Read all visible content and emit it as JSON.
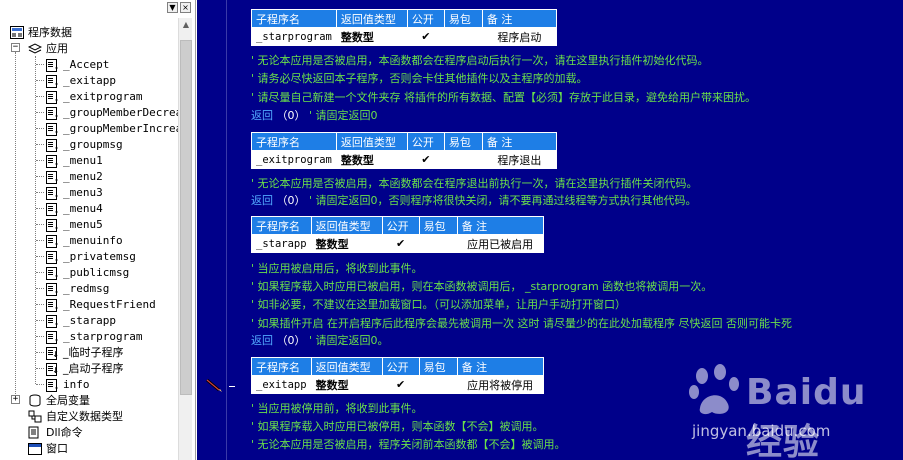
{
  "left_panel": {
    "controls": [
      "▼",
      "×"
    ],
    "tree": {
      "root": "程序数据",
      "app_node": "应用",
      "subprograms": [
        "_Accept",
        "_exitapp",
        "_exitprogram",
        "_groupMemberDecrea",
        "_groupMemberIncrea",
        "_groupmsg",
        "_menu1",
        "_menu2",
        "_menu3",
        "_menu4",
        "_menu5",
        "_menuinfo",
        "_privatemsg",
        "_publicmsg",
        "_redmsg",
        "_RequestFriend",
        "_starapp",
        "_starprogram",
        "_临时子程序",
        "_启动子程序",
        "info"
      ],
      "globals": "全局变量",
      "custom_types": "自定义数据类型",
      "dll": "Dll命令",
      "window": "窗口"
    }
  },
  "editor": {
    "table_headers": [
      "子程序名",
      "返回值类型",
      "公开",
      "易包",
      "备 注"
    ],
    "check_mark": "✔",
    "blocks": [
      {
        "name": "_starprogram",
        "ret_type": "整数型",
        "note": "程序启动",
        "comments": [
          "' 无论本应用是否被启用，本函数都会在程序启动后执行一次，请在这里执行插件初始化代码。",
          "' 请务必尽快返回本子程序，否则会卡住其他插件以及主程序的加载。",
          "' 请尽量自己新建一个文件夹存  将插件的所有数据、配置【必须】存放于此目录，避免给用户带来困扰。"
        ],
        "return_line": {
          "keyword": "返回",
          "value": "（0）",
          "comment": "' 请固定返回0"
        }
      },
      {
        "name": "_exitprogram",
        "ret_type": "整数型",
        "note": "程序退出",
        "comments": [
          "' 无论本应用是否被启用，本函数都会在程序退出前执行一次，请在这里执行插件关闭代码。"
        ],
        "return_line": {
          "keyword": "返回",
          "value": "（0）",
          "comment": "' 请固定返回0，否则程序将很快关闭，请不要再通过线程等方式执行其他代码。"
        }
      },
      {
        "name": "_starapp",
        "ret_type": "整数型",
        "note": "应用已被启用",
        "comments": [
          "' 当应用被启用后，将收到此事件。",
          "' 如果程序载入时应用已被启用，则在本函数被调用后， _starprogram 函数也将被调用一次。",
          "' 如非必要，不建议在这里加载窗口。（可以添加菜单，让用户手动打开窗口）",
          "' 如果插件开启 在开启程序后此程序会最先被调用一次 这时 请尽量少的在此处加载程序 尽快返回 否则可能卡死"
        ],
        "return_line": {
          "keyword": "返回",
          "value": "（0）",
          "comment": "' 请固定返回0。"
        }
      },
      {
        "name": "_exitapp",
        "ret_type": "整数型",
        "note": "应用将被停用",
        "comments": [
          "' 当应用被停用前，将收到此事件。",
          "' 如果程序载入时应用已被停用，则本函数【不会】被调用。",
          "' 无论本应用是否被启用，程序关闭前本函数都【不会】被调用。"
        ]
      }
    ]
  },
  "watermark": {
    "brand": "Baidu经验",
    "url": "jingyan.baidu.com"
  }
}
